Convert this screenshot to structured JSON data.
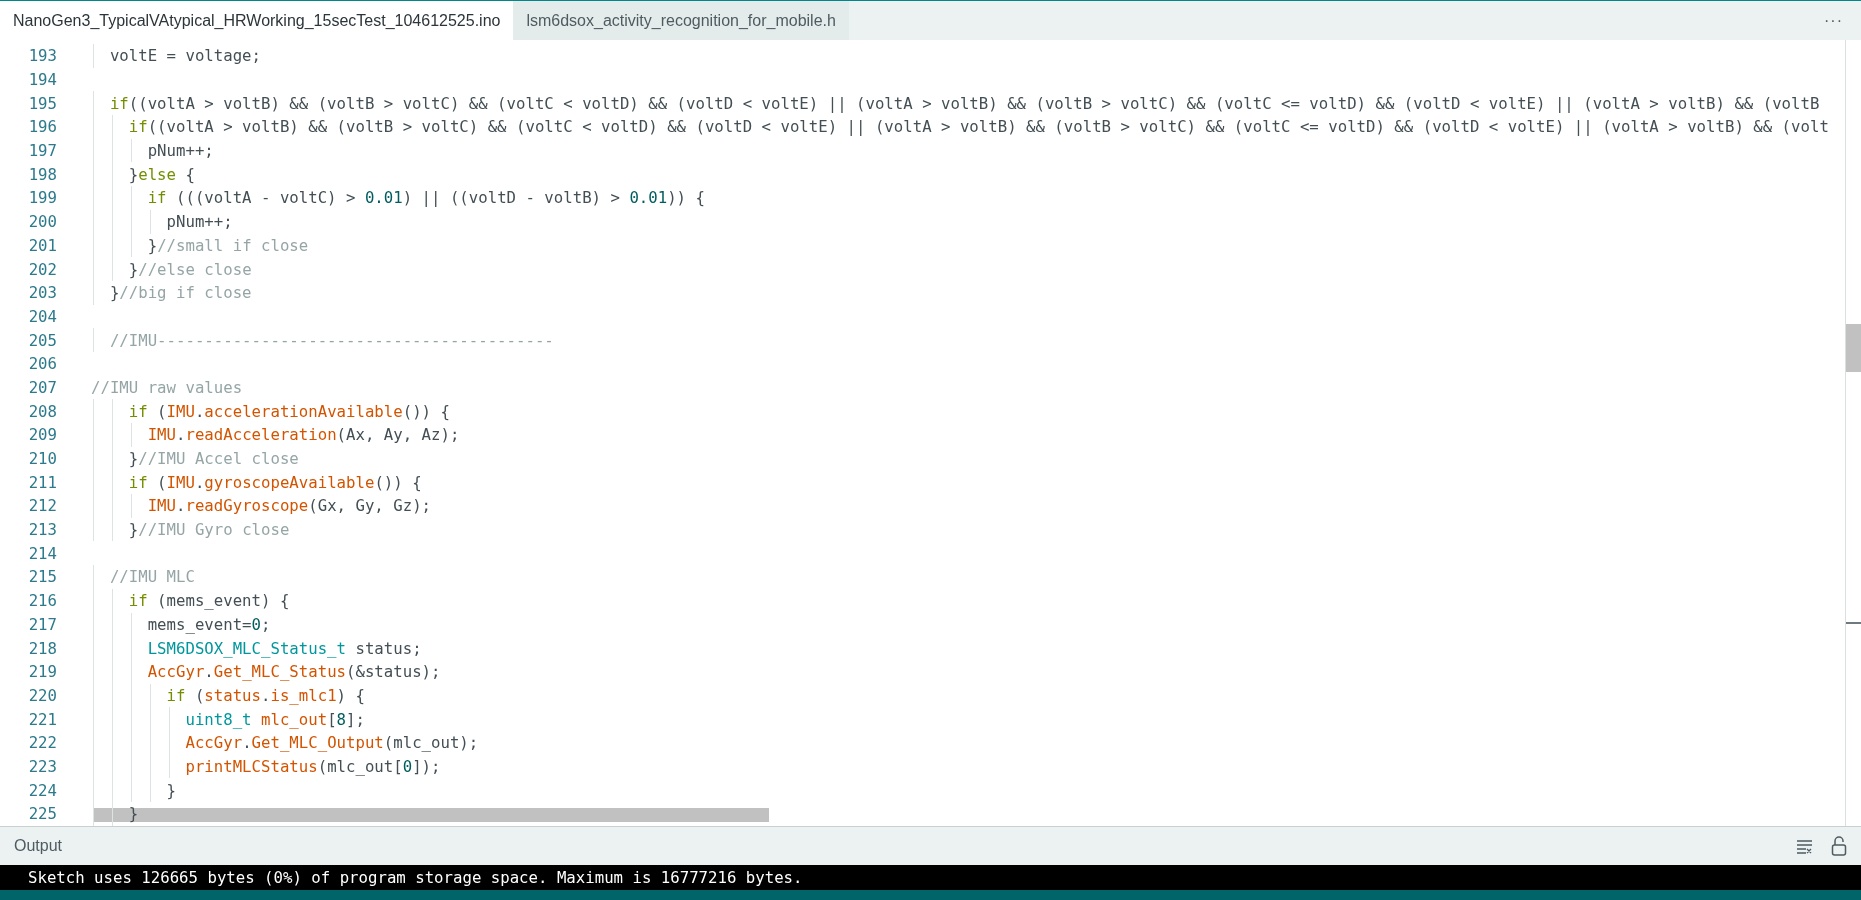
{
  "tabs": [
    {
      "label": "NanoGen3_TypicalVAtypical_HRWorking_15secTest_104612525.ino",
      "selected": true
    },
    {
      "label": "lsm6dsox_activity_recognition_for_mobile.h",
      "selected": false
    }
  ],
  "more_button": "···",
  "editor": {
    "lines": [
      {
        "number": "193",
        "code": [
          {
            "kind": "plain",
            "text": "  voltE = voltage;"
          }
        ]
      },
      {
        "number": "194"
      },
      {
        "number": "195",
        "code": [
          {
            "kind": "keyword",
            "text": "  if"
          },
          {
            "kind": "plain",
            "text": "((voltA > voltB) && (voltB > voltC) && (voltC < voltD) && (voltD < voltE) || (voltA > voltB) && (voltB > voltC) && (voltC <= voltD) && (voltD < voltE) || (voltA > voltB) && (voltB"
          }
        ]
      },
      {
        "number": "196",
        "code": [
          {
            "kind": "keyword",
            "text": "    if"
          },
          {
            "kind": "plain",
            "text": "((voltA > voltB) && (voltB > voltC) && (voltC < voltD) && (voltD < voltE) || (voltA > voltB) && (voltB > voltC) && (voltC <= voltD) && (voltD < voltE) || (voltA > voltB) && (volt"
          }
        ]
      },
      {
        "number": "197",
        "code": [
          {
            "kind": "plain",
            "text": "      pNum++;"
          }
        ]
      },
      {
        "number": "198",
        "code": [
          {
            "kind": "plain",
            "text": "    }"
          },
          {
            "kind": "keyword",
            "text": "else"
          },
          {
            "kind": "plain",
            "text": " {"
          }
        ]
      },
      {
        "number": "199",
        "code": [
          {
            "kind": "keyword",
            "text": "      if"
          },
          {
            "kind": "plain",
            "text": " (((voltA - voltC) > "
          },
          {
            "kind": "number",
            "text": "0.01"
          },
          {
            "kind": "plain",
            "text": ") || ((voltD - voltB) > "
          },
          {
            "kind": "number",
            "text": "0.01"
          },
          {
            "kind": "plain",
            "text": ")) {"
          }
        ]
      },
      {
        "number": "200",
        "code": [
          {
            "kind": "plain",
            "text": "        pNum++;"
          }
        ]
      },
      {
        "number": "201",
        "code": [
          {
            "kind": "plain",
            "text": "      }"
          },
          {
            "kind": "comment",
            "text": "//small if close"
          }
        ]
      },
      {
        "number": "202",
        "code": [
          {
            "kind": "plain",
            "text": "    }"
          },
          {
            "kind": "comment",
            "text": "//else close"
          }
        ]
      },
      {
        "number": "203",
        "code": [
          {
            "kind": "plain",
            "text": "  }"
          },
          {
            "kind": "comment",
            "text": "//big if close"
          }
        ]
      },
      {
        "number": "204"
      },
      {
        "number": "205",
        "code": [
          {
            "kind": "comment",
            "text": "  //IMU------------------------------------------"
          }
        ]
      },
      {
        "number": "206"
      },
      {
        "number": "207",
        "code": [
          {
            "kind": "comment",
            "text": "//IMU raw values"
          }
        ]
      },
      {
        "number": "208",
        "code": [
          {
            "kind": "keyword",
            "text": "    if"
          },
          {
            "kind": "plain",
            "text": " ("
          },
          {
            "kind": "function",
            "text": "IMU"
          },
          {
            "kind": "plain",
            "text": "."
          },
          {
            "kind": "function",
            "text": "accelerationAvailable"
          },
          {
            "kind": "plain",
            "text": "()) {"
          }
        ]
      },
      {
        "number": "209",
        "code": [
          {
            "kind": "function",
            "text": "      IMU"
          },
          {
            "kind": "plain",
            "text": "."
          },
          {
            "kind": "function",
            "text": "readAcceleration"
          },
          {
            "kind": "plain",
            "text": "(Ax, Ay, Az);"
          }
        ]
      },
      {
        "number": "210",
        "code": [
          {
            "kind": "plain",
            "text": "    }"
          },
          {
            "kind": "comment",
            "text": "//IMU Accel close"
          }
        ]
      },
      {
        "number": "211",
        "code": [
          {
            "kind": "keyword",
            "text": "    if"
          },
          {
            "kind": "plain",
            "text": " ("
          },
          {
            "kind": "function",
            "text": "IMU"
          },
          {
            "kind": "plain",
            "text": "."
          },
          {
            "kind": "function",
            "text": "gyroscopeAvailable"
          },
          {
            "kind": "plain",
            "text": "()) {"
          }
        ]
      },
      {
        "number": "212",
        "code": [
          {
            "kind": "function",
            "text": "      IMU"
          },
          {
            "kind": "plain",
            "text": "."
          },
          {
            "kind": "function",
            "text": "readGyroscope"
          },
          {
            "kind": "plain",
            "text": "(Gx, Gy, Gz);"
          }
        ]
      },
      {
        "number": "213",
        "code": [
          {
            "kind": "plain",
            "text": "    }"
          },
          {
            "kind": "comment",
            "text": "//IMU Gyro close"
          }
        ]
      },
      {
        "number": "214"
      },
      {
        "number": "215",
        "code": [
          {
            "kind": "comment",
            "text": "  //IMU MLC"
          }
        ]
      },
      {
        "number": "216",
        "code": [
          {
            "kind": "keyword",
            "text": "    if"
          },
          {
            "kind": "plain",
            "text": " (mems_event) {"
          }
        ]
      },
      {
        "number": "217",
        "code": [
          {
            "kind": "plain",
            "text": "      mems_event="
          },
          {
            "kind": "number",
            "text": "0"
          },
          {
            "kind": "plain",
            "text": ";"
          }
        ]
      },
      {
        "number": "218",
        "code": [
          {
            "kind": "type",
            "text": "      LSM6DSOX_MLC_Status_t"
          },
          {
            "kind": "plain",
            "text": " status;"
          }
        ]
      },
      {
        "number": "219",
        "code": [
          {
            "kind": "function",
            "text": "      AccGyr"
          },
          {
            "kind": "plain",
            "text": "."
          },
          {
            "kind": "function",
            "text": "Get_MLC_Status"
          },
          {
            "kind": "plain",
            "text": "(&status);"
          }
        ]
      },
      {
        "number": "220",
        "code": [
          {
            "kind": "keyword",
            "text": "        if"
          },
          {
            "kind": "plain",
            "text": " ("
          },
          {
            "kind": "function",
            "text": "status"
          },
          {
            "kind": "plain",
            "text": "."
          },
          {
            "kind": "function",
            "text": "is_mlc1"
          },
          {
            "kind": "plain",
            "text": ") {"
          }
        ]
      },
      {
        "number": "221",
        "code": [
          {
            "kind": "type",
            "text": "          uint8_t"
          },
          {
            "kind": "function",
            "text": " mlc_out"
          },
          {
            "kind": "plain",
            "text": "["
          },
          {
            "kind": "number",
            "text": "8"
          },
          {
            "kind": "plain",
            "text": "];"
          }
        ]
      },
      {
        "number": "222",
        "code": [
          {
            "kind": "function",
            "text": "          AccGyr"
          },
          {
            "kind": "plain",
            "text": "."
          },
          {
            "kind": "function",
            "text": "Get_MLC_Output"
          },
          {
            "kind": "plain",
            "text": "(mlc_out);"
          }
        ]
      },
      {
        "number": "223",
        "code": [
          {
            "kind": "function",
            "text": "          printMLCStatus"
          },
          {
            "kind": "plain",
            "text": "(mlc_out["
          },
          {
            "kind": "number",
            "text": "0"
          },
          {
            "kind": "plain",
            "text": "]);"
          }
        ]
      },
      {
        "number": "224",
        "code": [
          {
            "kind": "plain",
            "text": "        }"
          }
        ]
      },
      {
        "number": "225",
        "code": [
          {
            "kind": "plain",
            "text": "    }"
          }
        ]
      }
    ]
  },
  "output": {
    "title": "Output",
    "lines": [
      "Sketch uses 126665 bytes (0%) of program storage space. Maximum is 16777216 bytes."
    ]
  }
}
